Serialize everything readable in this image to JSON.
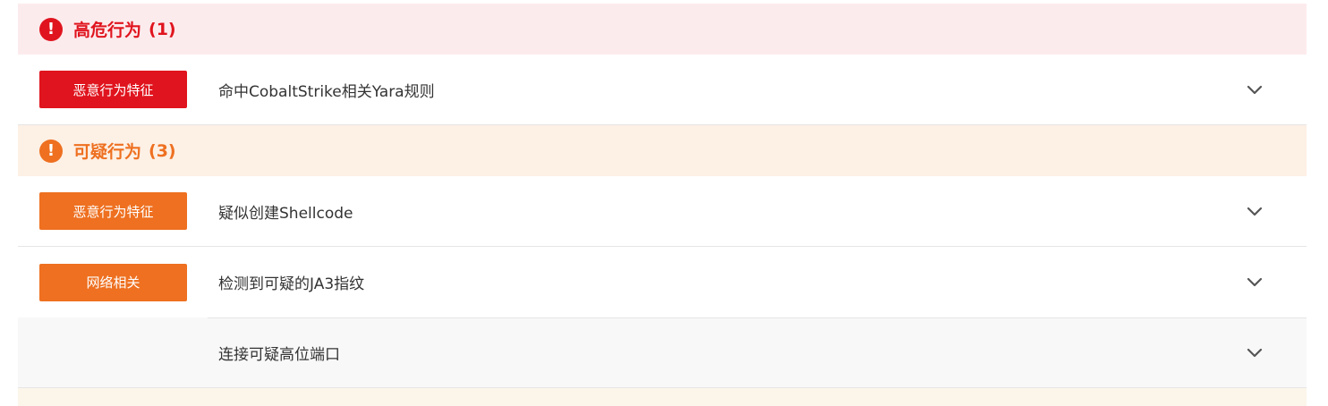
{
  "sections": [
    {
      "severity": "high",
      "icon": "exclamation-circle-icon",
      "title": "高危行为",
      "count": "(1)",
      "color": "#e0141e",
      "items": [
        {
          "tag": "恶意行为特征",
          "text": "命中CobaltStrike相关Yara规则"
        }
      ]
    },
    {
      "severity": "suspicious",
      "icon": "exclamation-circle-icon",
      "title": "可疑行为",
      "count": "(3)",
      "color": "#ee7020",
      "items": [
        {
          "tag": "恶意行为特征",
          "text": "疑似创建Shellcode"
        },
        {
          "tag": "网络相关",
          "text": "检测到可疑的JA3指纹"
        },
        {
          "tag": "",
          "text": "连接可疑高位端口"
        }
      ]
    }
  ],
  "icons": {
    "expand": "chevron-down-icon"
  }
}
